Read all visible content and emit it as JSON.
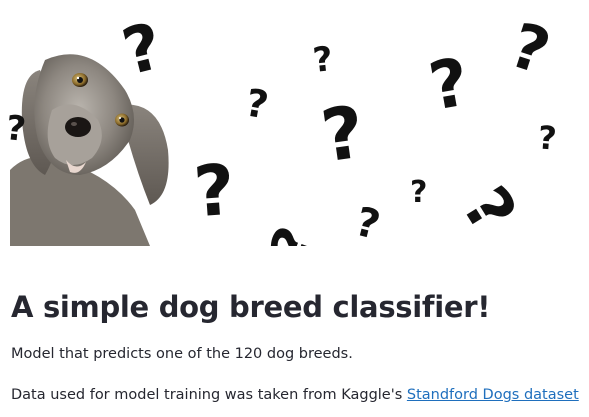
{
  "banner": {
    "dog_image": "dog-head-tilt",
    "question_mark": "?"
  },
  "header": {
    "title": "A simple dog breed classifier!"
  },
  "main": {
    "description": "Model that predicts one of the 120 dog breeds.",
    "data_source_prefix": "Data used for model training was taken from Kaggle's ",
    "data_source_link": "Standford Dogs dataset"
  }
}
